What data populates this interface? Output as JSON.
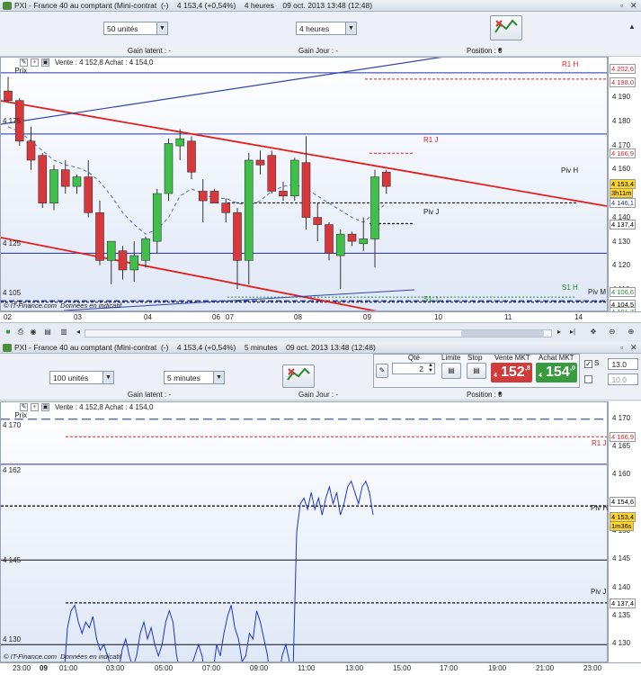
{
  "top_window": {
    "title": "PXI - France 40 au comptant (Mini-contrat  (-)    4 153,4 (+0,54%)    4 heures    09 oct. 2013 13:48 (12:48)",
    "units_select": "50 unités",
    "interval_select": "4 heures",
    "gain_latent": "Gain latent : -",
    "gain_jour": "Gain Jour : -",
    "position": "Position : 0",
    "chart_header": "Vente : 4 152,8 Achat : 4 154,0",
    "prix_label": "Prix",
    "watermark": "© IT-Finance.com  Données en indicatif",
    "left_labels": [
      "4 175",
      "4 125",
      "4 105"
    ],
    "line_labels": {
      "r1h": "R1 H",
      "r1j": "R1 J",
      "pivh": "Piv H",
      "pivj": "Piv J",
      "s1h": "S1 H",
      "s1j": "S1 J",
      "pivm": "Piv M"
    },
    "y_ticks": [
      "4 190",
      "4 180",
      "4 170",
      "4 160",
      "4 150",
      "4 140",
      "4 130",
      "4 120",
      "4 110"
    ],
    "y_tags": {
      "r1h_top": "4 202,6",
      "r1h": "4 198,0",
      "r1j": "4 166,9",
      "last": "4 153,4",
      "countdown": "3h11m",
      "pivh": "4 146,1",
      "pivj": "4 137,4",
      "s1": "4 106,6",
      "pivm": "4 104,5",
      "low": "4 101,7"
    },
    "x_ticks": [
      "02",
      "03",
      "04",
      "06",
      "07",
      "08",
      "09",
      "10",
      "11",
      "14"
    ]
  },
  "bottom_window": {
    "title": "PXI - France 40 au comptant (Mini-contrat  (-)    4 153,4 (+0,54%)    5 minutes    09 oct. 2013 13:48 (12:48)",
    "units_select": "100 unités",
    "interval_select": "5 minutes",
    "qty_label": "Qté",
    "qty_value": "2",
    "limit_label": "Limite",
    "stop_label": "Stop",
    "sell_label": "Vente MKT",
    "buy_label": "Achat MKT",
    "sell_price_small": "4",
    "sell_price": "152",
    "sell_price_sup": ",8",
    "buy_price_small": "4",
    "buy_price": "154",
    "buy_price_sup": ",0",
    "s_label": "S",
    "s_value": "13.0",
    "l_value": "10.0",
    "gain_latent": "Gain latent : -",
    "gain_jour": "Gain Jour : -",
    "position": "Position : 0",
    "chart_header": "Vente : 4 152,8 Achat : 4 154,0",
    "prix_label": "Prix",
    "watermark": "© IT-Finance.com  Données en indicatif",
    "left_labels": [
      "4 170",
      "4 162",
      "4 145",
      "4 130"
    ],
    "line_labels": {
      "r1j": "R1 J",
      "pivh": "Piv H",
      "pivj": "Piv J"
    },
    "y_ticks": [
      "4 170",
      "4 165",
      "4 160",
      "4 150",
      "4 145",
      "4 140",
      "4 135",
      "4 130"
    ],
    "y_tags": {
      "r1j": "4 166,9",
      "last": "4 153,4",
      "pivh": "4 154,6",
      "countdown": "1m36s",
      "pivj": "4 137,4"
    },
    "x_ticks": [
      "23:00",
      "09",
      "01:00",
      "03:00",
      "05:00",
      "07:00",
      "09:00",
      "11:00",
      "13:00",
      "15:00",
      "17:00",
      "19:00",
      "21:00",
      "23:00"
    ]
  },
  "colors": {
    "up": "#3fc04a",
    "down": "#d8383c",
    "channel": "#e41d1d",
    "level": "#2233aa",
    "ma": "#5a6fa8"
  },
  "chart_data": [
    {
      "type": "candlestick",
      "title": "PXI - France 40 au comptant (Mini-contrat",
      "interval": "4 heures",
      "ylim": [
        4101,
        4207
      ],
      "x_ticks": [
        "02",
        "03",
        "04",
        "06",
        "07",
        "08",
        "09",
        "10",
        "11",
        "14"
      ],
      "candles": [
        {
          "o": 4193,
          "h": 4199,
          "l": 4188,
          "c": 4189
        },
        {
          "o": 4189,
          "h": 4190,
          "l": 4170,
          "c": 4172
        },
        {
          "o": 4172,
          "h": 4178,
          "l": 4160,
          "c": 4164
        },
        {
          "o": 4166,
          "h": 4167,
          "l": 4144,
          "c": 4146
        },
        {
          "o": 4146,
          "h": 4162,
          "l": 4143,
          "c": 4160
        },
        {
          "o": 4160,
          "h": 4164,
          "l": 4150,
          "c": 4153
        },
        {
          "o": 4153,
          "h": 4158,
          "l": 4150,
          "c": 4157
        },
        {
          "o": 4157,
          "h": 4164,
          "l": 4140,
          "c": 4142
        },
        {
          "o": 4142,
          "h": 4147,
          "l": 4120,
          "c": 4122
        },
        {
          "o": 4122,
          "h": 4130,
          "l": 4112,
          "c": 4130
        },
        {
          "o": 4126,
          "h": 4128,
          "l": 4114,
          "c": 4118
        },
        {
          "o": 4118,
          "h": 4130,
          "l": 4113,
          "c": 4124
        },
        {
          "o": 4122,
          "h": 4132,
          "l": 4119,
          "c": 4131
        },
        {
          "o": 4130,
          "h": 4152,
          "l": 4125,
          "c": 4150
        },
        {
          "o": 4150,
          "h": 4173,
          "l": 4147,
          "c": 4171
        },
        {
          "o": 4170,
          "h": 4177,
          "l": 4164,
          "c": 4173
        },
        {
          "o": 4172,
          "h": 4174,
          "l": 4156,
          "c": 4159
        },
        {
          "o": 4151,
          "h": 4156,
          "l": 4138,
          "c": 4147
        },
        {
          "o": 4151,
          "h": 4152,
          "l": 4146,
          "c": 4146
        },
        {
          "o": 4146,
          "h": 4148,
          "l": 4138,
          "c": 4142
        },
        {
          "o": 4142,
          "h": 4144,
          "l": 4110,
          "c": 4122
        },
        {
          "o": 4122,
          "h": 4167,
          "l": 4112,
          "c": 4164
        },
        {
          "o": 4164,
          "h": 4168,
          "l": 4158,
          "c": 4162
        },
        {
          "o": 4166,
          "h": 4168,
          "l": 4150,
          "c": 4151
        },
        {
          "o": 4151,
          "h": 4155,
          "l": 4147,
          "c": 4149
        },
        {
          "o": 4149,
          "h": 4165,
          "l": 4147,
          "c": 4164
        },
        {
          "o": 4163,
          "h": 4174,
          "l": 4135,
          "c": 4140
        },
        {
          "o": 4140,
          "h": 4146,
          "l": 4130,
          "c": 4137
        },
        {
          "o": 4137,
          "h": 4138,
          "l": 4122,
          "c": 4125
        },
        {
          "o": 4124,
          "h": 4135,
          "l": 4110,
          "c": 4133
        },
        {
          "o": 4133,
          "h": 4134,
          "l": 4128,
          "c": 4130
        },
        {
          "o": 4129,
          "h": 4140,
          "l": 4126,
          "c": 4131
        },
        {
          "o": 4131,
          "h": 4160,
          "l": 4119,
          "c": 4157
        },
        {
          "o": 4159,
          "h": 4160,
          "l": 4150,
          "c": 4153
        }
      ],
      "moving_average": [
        4178,
        4176,
        4172,
        4168,
        4164,
        4162,
        4161,
        4159,
        4155,
        4149,
        4142,
        4137,
        4133,
        4135,
        4140,
        4149,
        4152,
        4150,
        4148,
        4148,
        4146,
        4145,
        4147,
        4151,
        4153,
        4154,
        4152,
        4149,
        4146,
        4143,
        4140,
        4138,
        4142,
        4146
      ],
      "levels": {
        "r1h": 4198.0,
        "r1j": 4166.9,
        "pivh": 4146.1,
        "pivj": 4137.4,
        "s1": 4106.6,
        "pivm": 4104.5,
        "blue_upper": 4175,
        "blue_lower": 4125,
        "blue_bottom": 4105
      }
    },
    {
      "type": "line",
      "title": "PXI - France 40 au comptant (Mini-contrat",
      "interval": "5 minutes",
      "ylim": [
        4127,
        4173
      ],
      "x_ticks": [
        "23:00",
        "09",
        "01:00",
        "03:00",
        "05:00",
        "07:00",
        "09:00",
        "11:00",
        "13:00",
        "15:00",
        "17:00",
        "19:00",
        "21:00",
        "23:00"
      ],
      "series": [
        {
          "values": [
            4124,
            4133,
            4136,
            4137,
            4134,
            4132,
            4134,
            4133,
            4135,
            4131,
            4129,
            4130,
            4128,
            4126,
            4124,
            4125,
            4129,
            4131,
            4128,
            4126,
            4128,
            4132,
            4134,
            4131,
            4133,
            4130,
            4128,
            4130,
            4134,
            4136,
            4134,
            4128,
            4125,
            4124,
            4123,
            4126,
            4128,
            4130,
            4128,
            4124,
            4122,
            4125,
            4130,
            4128,
            4132,
            4135,
            4137,
            4133,
            4131,
            4127,
            4128,
            4132,
            4131,
            4136,
            4134,
            4131,
            4128,
            4122,
            4120,
            4124,
            4128,
            4130,
            4127,
            4125,
            4150,
            4155,
            4156,
            4154,
            4157,
            4154,
            4156,
            4153,
            4156,
            4158,
            4155,
            4157,
            4153,
            4155,
            4158,
            4159,
            4157,
            4155,
            4158,
            4159,
            4157,
            4153
          ]
        }
      ],
      "levels": {
        "blue_top": 4170,
        "r1j": 4166.9,
        "blue_162": 4162,
        "pivh": 4154.6,
        "black_145": 4145,
        "pivj": 4137.4,
        "black_130": 4130
      }
    }
  ]
}
